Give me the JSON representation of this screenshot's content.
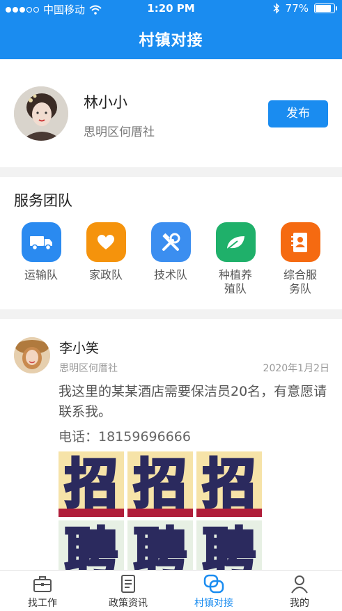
{
  "status_bar": {
    "carrier": "中国移动",
    "time": "1:20 PM",
    "battery": "77%"
  },
  "header": {
    "title": "村镇对接"
  },
  "profile": {
    "name": "林小小",
    "location": "思明区何厝社",
    "publish_label": "发布"
  },
  "services": {
    "title": "服务团队",
    "items": [
      {
        "label": "运输队",
        "icon": "truck-icon",
        "color": "#2a8af0"
      },
      {
        "label": "家政队",
        "icon": "heart-icon",
        "color": "#f5930c"
      },
      {
        "label": "技术队",
        "icon": "tools-icon",
        "color": "#3b8ef0"
      },
      {
        "label": "种植养殖队",
        "icon": "leaf-icon",
        "color": "#1fb06a"
      },
      {
        "label": "综合服务队",
        "icon": "contact-card-icon",
        "color": "#f56a11"
      }
    ]
  },
  "post": {
    "author": "李小笑",
    "location": "思明区何厝社",
    "date": "2020年1月2日",
    "text": "我这里的某某酒店需要保洁员20名，有意愿请联系我。",
    "phone": "电话：18159696666",
    "images": [
      "招",
      "招",
      "招",
      "聘",
      "聘",
      "聘"
    ]
  },
  "tabbar": {
    "items": [
      {
        "label": "找工作",
        "icon": "briefcase-icon",
        "active": false
      },
      {
        "label": "政策资讯",
        "icon": "document-icon",
        "active": false
      },
      {
        "label": "村镇对接",
        "icon": "connect-icon",
        "active": true
      },
      {
        "label": "我的",
        "icon": "user-icon",
        "active": false
      }
    ]
  },
  "colors": {
    "primary": "#1a8cf0",
    "background": "#f2f2f2"
  }
}
